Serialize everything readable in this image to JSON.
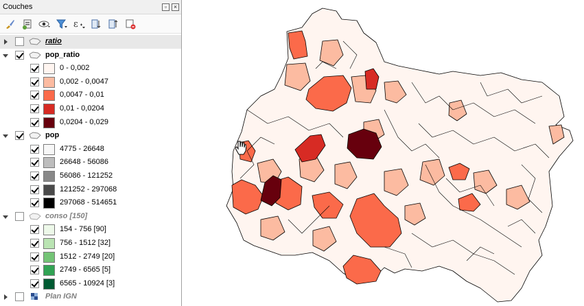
{
  "panel": {
    "title": "Couches"
  },
  "toolbar": {
    "icons": [
      "style-brush-icon",
      "add-group-icon",
      "visibility-eye-icon",
      "filter-icon",
      "expression-epsilon-icon",
      "expand-all-icon",
      "collapse-all-icon",
      "remove-layer-icon"
    ]
  },
  "layers": [
    {
      "name": "ratio",
      "expanded": false,
      "checked": false,
      "style": "italic-underline",
      "classes": []
    },
    {
      "name": "pop_ratio",
      "expanded": true,
      "checked": true,
      "style": "bold",
      "classes": [
        {
          "label": "0 - 0,002",
          "color": "#fff5f0"
        },
        {
          "label": "0,002 - 0,0047",
          "color": "#fcbba1"
        },
        {
          "label": "0,0047 - 0,01",
          "color": "#fb6a4a"
        },
        {
          "label": "0,01 - 0,0204",
          "color": "#d72b24"
        },
        {
          "label": "0,0204 - 0,029",
          "color": "#67000d"
        }
      ]
    },
    {
      "name": "pop",
      "expanded": true,
      "checked": true,
      "style": "bold",
      "classes": [
        {
          "label": "4775 - 26648",
          "color": "#f7f7f7"
        },
        {
          "label": "26648 - 56086",
          "color": "#bdbdbd"
        },
        {
          "label": "56086 - 121252",
          "color": "#888888"
        },
        {
          "label": "121252 - 297068",
          "color": "#4a4a4a"
        },
        {
          "label": "297068 - 514651",
          "color": "#000000"
        }
      ]
    },
    {
      "name": "conso [150]",
      "expanded": true,
      "checked": false,
      "style": "disabled",
      "classes": [
        {
          "label": "154 - 756 [90]",
          "color": "#edf8e9"
        },
        {
          "label": "756 - 1512 [32]",
          "color": "#bae4b3"
        },
        {
          "label": "1512 - 2749 [20]",
          "color": "#74c476"
        },
        {
          "label": "2749 - 6565 [5]",
          "color": "#31a354"
        },
        {
          "label": "6565 - 10924 [3]",
          "color": "#005a32"
        }
      ]
    },
    {
      "name": "Plan IGN",
      "expanded": false,
      "checked": false,
      "style": "disabled-raster",
      "classes": []
    }
  ]
}
